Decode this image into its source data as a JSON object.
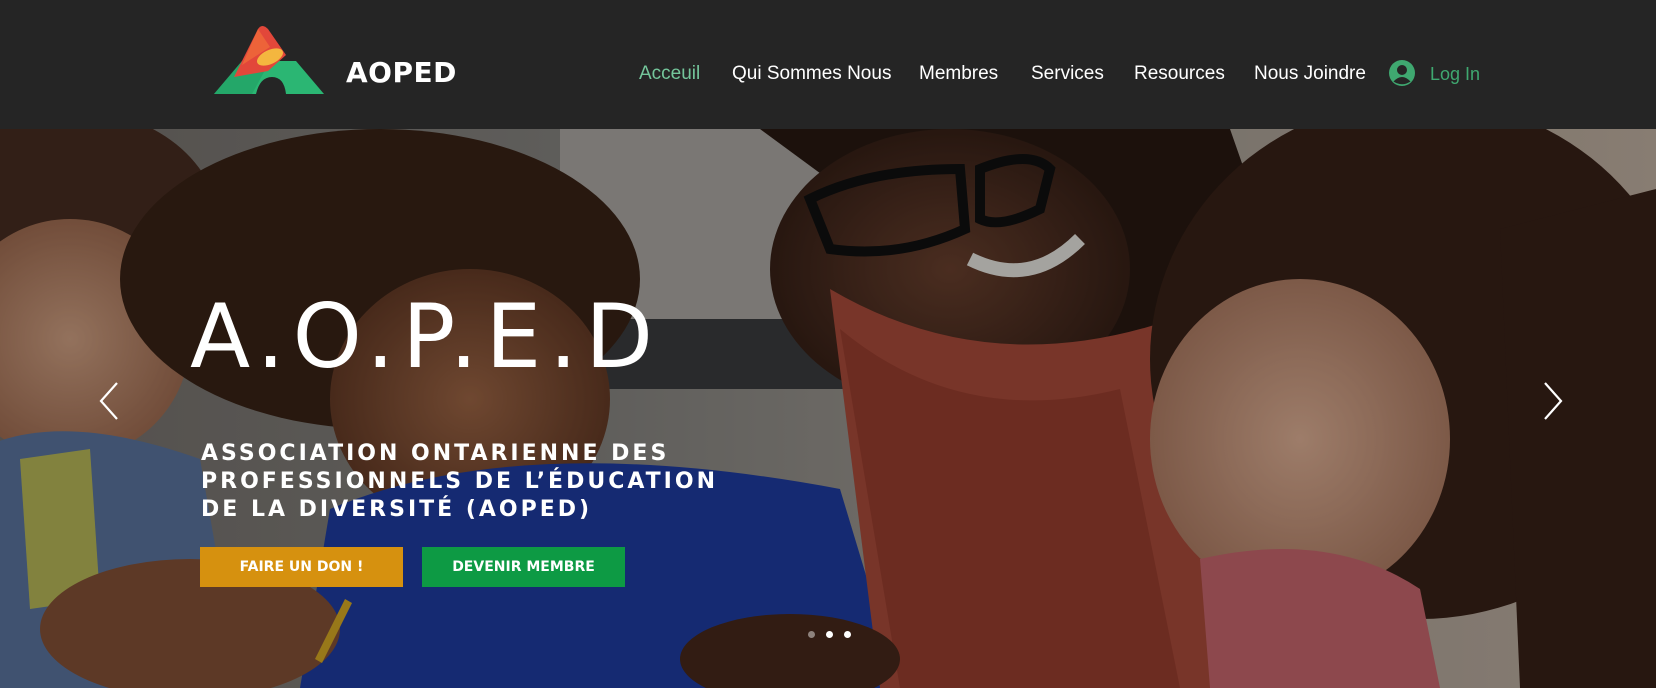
{
  "header": {
    "brand": "AOPED",
    "nav": [
      {
        "label": "Acceuil",
        "active": true
      },
      {
        "label": "Qui Sommes Nous",
        "active": false
      },
      {
        "label": "Membres",
        "active": false
      },
      {
        "label": "Services",
        "active": false
      },
      {
        "label": "Resources",
        "active": false
      },
      {
        "label": "Nous Joindre",
        "active": false
      }
    ],
    "login_label": "Log In"
  },
  "hero": {
    "title": "A.O.P.E.D",
    "subtitle_lines": [
      "ASSOCIATION ONTARIENNE DES",
      "PROFESSIONNELS DE L’ÉDUCATION",
      "DE LA DIVERSITÉ (AOPED)"
    ],
    "donate_label": "FAIRE UN DON !",
    "member_label": "DEVENIR MEMBRE",
    "slides_count": 3,
    "active_slide": 1
  },
  "colors": {
    "header_bg": "#252525",
    "nav_active": "#74c69b",
    "login": "#3fa870",
    "donate_btn": "#d6910f",
    "member_btn": "#0d9a44"
  },
  "icons": {
    "logo": "aoped-logo",
    "login_avatar": "user-avatar-icon",
    "prev": "chevron-left-icon",
    "next": "chevron-right-icon"
  }
}
